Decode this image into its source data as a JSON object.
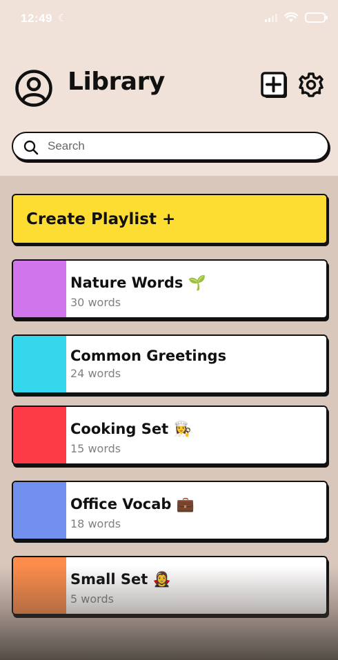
{
  "status_bar": {
    "time": "12:49"
  },
  "header": {
    "title": "Library"
  },
  "search": {
    "placeholder": "Search"
  },
  "create_playlist": {
    "label": "Create Playlist +"
  },
  "playlists": [
    {
      "name": "Nature Words 🌱",
      "count": "30 words",
      "color": "#d175ec"
    },
    {
      "name": "Common Greetings",
      "count": "24 words",
      "color": "#35d7ec"
    },
    {
      "name": "Cooking Set 👩‍🍳",
      "count": "15 words",
      "color": "#fc3b46"
    },
    {
      "name": "Office Vocab 💼",
      "count": "18 words",
      "color": "#7291ef"
    },
    {
      "name": "Small Set 🧛‍♀️",
      "count": "5 words",
      "color": "#fb8c4b"
    }
  ],
  "icons": {
    "profile": "person-circle-icon",
    "add": "plus-square-icon",
    "settings": "gear-icon",
    "search": "search-icon",
    "moon": "moon-icon"
  },
  "colors": {
    "header_bg": "#f0e2d9",
    "list_bg": "#d9c7bc",
    "accent_yellow": "#fedd33",
    "outline": "#111111"
  }
}
